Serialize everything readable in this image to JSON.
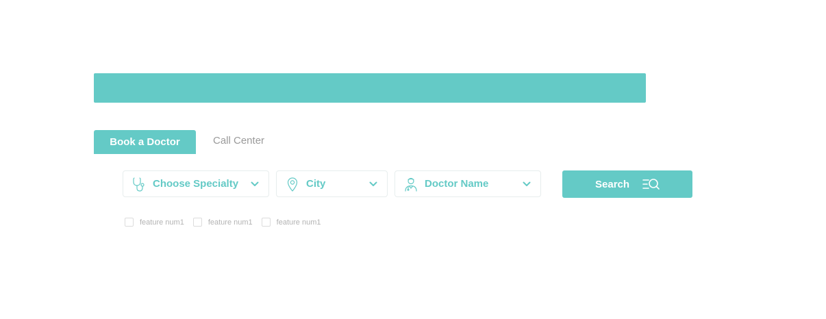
{
  "colors": {
    "accent": "#64cac6",
    "inactive_text": "#9a9a9a",
    "field_border": "#e7eded",
    "feature_text": "#b3b3b3"
  },
  "tabs": [
    {
      "label": "Book a Doctor",
      "active": true
    },
    {
      "label": "Call Center",
      "active": false
    }
  ],
  "search_form": {
    "specialty": {
      "label": "Choose Specialty",
      "icon": "stethoscope-icon"
    },
    "city": {
      "label": "City",
      "icon": "location-pin-icon"
    },
    "doctor": {
      "label": "Doctor Name",
      "icon": "doctor-icon"
    },
    "search_button": {
      "label": "Search",
      "icon": "search-list-icon"
    }
  },
  "features": [
    {
      "label": "feature num1",
      "checked": false
    },
    {
      "label": "feature num1",
      "checked": false
    },
    {
      "label": "feature num1",
      "checked": false
    }
  ]
}
